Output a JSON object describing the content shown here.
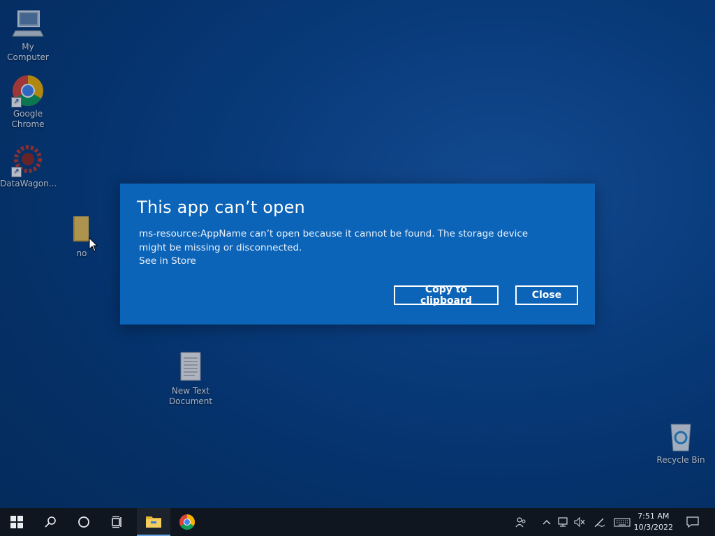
{
  "desktop": {
    "icons": [
      {
        "label": "My Computer",
        "icon": "computer-icon"
      },
      {
        "label": "Google Chrome",
        "icon": "chrome-icon"
      },
      {
        "label": "DataWagon...",
        "icon": "gear-icon"
      },
      {
        "label": "no",
        "icon": "folder-icon"
      },
      {
        "label": "New Text Document",
        "icon": "text-file-icon"
      },
      {
        "label": "Recycle Bin",
        "icon": "recycle-bin-icon"
      }
    ]
  },
  "dialog": {
    "title": "This app can’t open",
    "message": "ms-resource:AppName can’t open because it cannot be found. The storage device might be missing or disconnected.",
    "link": "See in Store",
    "copy_label": "Copy to clipboard",
    "close_label": "Close",
    "background_color": "#0c64b8"
  },
  "taskbar": {
    "items": [
      "start-icon",
      "search-icon",
      "cortana-icon",
      "task-view-icon",
      "file-explorer-icon",
      "chrome-icon"
    ],
    "tray": [
      "people-icon",
      "chevron-up-icon",
      "network-icon",
      "volume-muted-icon",
      "pen-icon",
      "keyboard-icon",
      "notification-icon"
    ],
    "time": "7:51 AM",
    "date": "10/3/2022"
  }
}
